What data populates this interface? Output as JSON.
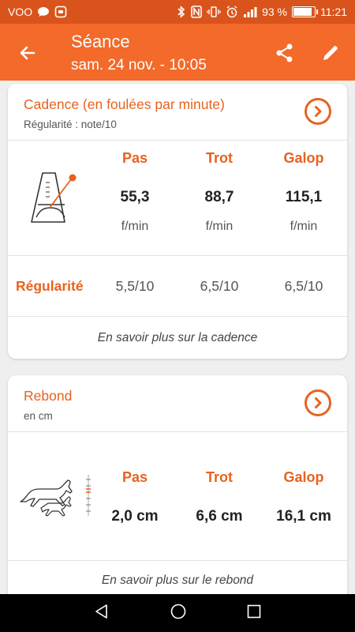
{
  "status_bar": {
    "carrier": "VOO",
    "battery_percent": "93 %",
    "time": "11:21"
  },
  "app_bar": {
    "title": "Séance",
    "subtitle": "sam. 24 nov. - 10:05"
  },
  "cadence": {
    "title": "Cadence (en foulées par minute)",
    "subtitle": "Régularité : note/10",
    "columns": [
      {
        "name": "Pas",
        "value": "55,3",
        "unit": "f/min",
        "regularity": "5,5/10"
      },
      {
        "name": "Trot",
        "value": "88,7",
        "unit": "f/min",
        "regularity": "6,5/10"
      },
      {
        "name": "Galop",
        "value": "115,1",
        "unit": "f/min",
        "regularity": "6,5/10"
      }
    ],
    "regularity_label": "Régularité",
    "more_link": "En savoir plus sur la cadence"
  },
  "rebond": {
    "title": "Rebond",
    "subtitle": "en cm",
    "columns": [
      {
        "name": "Pas",
        "value": "2,0 cm"
      },
      {
        "name": "Trot",
        "value": "6,6 cm"
      },
      {
        "name": "Galop",
        "value": "16,1 cm"
      }
    ],
    "more_link": "En savoir plus sur le rebond"
  },
  "colors": {
    "status_bar": "#d9541c",
    "app_bar": "#f36a2a",
    "accent": "#e8621f",
    "background": "#efefef"
  },
  "icons": {
    "back": "arrow-left-icon",
    "share": "share-icon",
    "edit": "pencil-icon",
    "details": "chevron-circle-right-icon",
    "cadence": "metronome-icon",
    "rebound": "horses-icon"
  }
}
